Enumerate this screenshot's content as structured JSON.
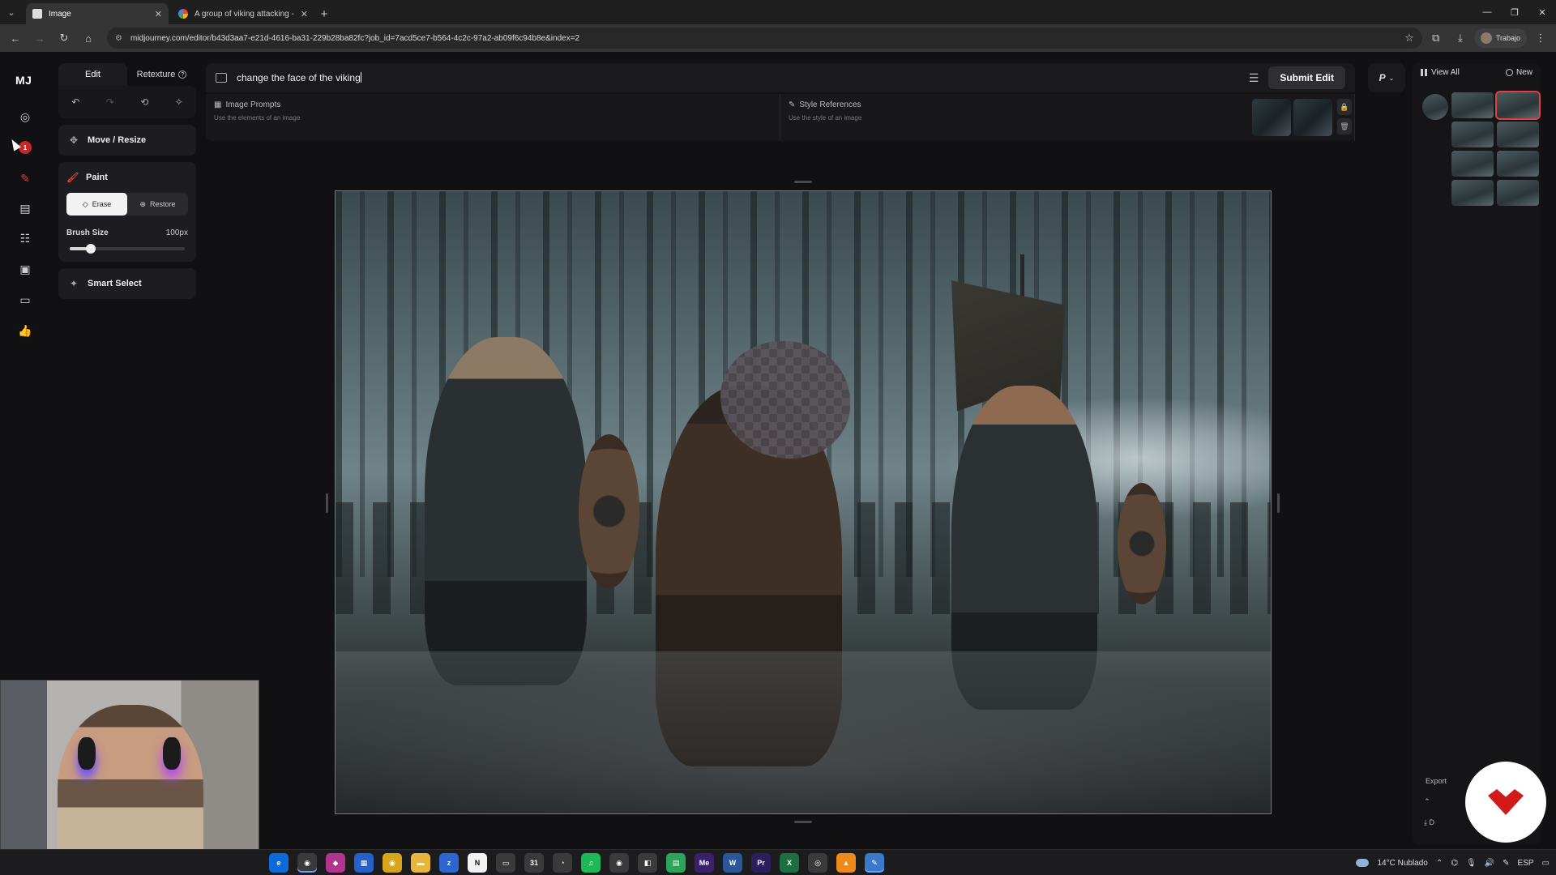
{
  "browser": {
    "tabs": [
      {
        "title": "Image",
        "active": true
      },
      {
        "title": "A group of viking attacking - G",
        "active": false
      }
    ],
    "url": "midjourney.com/editor/b43d3aa7-e21d-4616-ba31-229b28ba82fc?job_id=7acd5ce7-b564-4c2c-97a2-ab09f6c94b8e&index=2",
    "profile_label": "Trabajo"
  },
  "rail": {
    "logo": "MJ",
    "notification_count": "1"
  },
  "tools": {
    "tab_edit": "Edit",
    "tab_retexture": "Retexture",
    "move_resize": "Move / Resize",
    "paint": "Paint",
    "erase": "Erase",
    "restore": "Restore",
    "brush_size_label": "Brush Size",
    "brush_size_value": "100px",
    "brush_size_fraction": 0.18,
    "smart_select": "Smart Select"
  },
  "prompt": {
    "text": "change the face of the viking",
    "submit_label": "Submit Edit",
    "param_menu": "P"
  },
  "references": {
    "image_prompts_title": "Image Prompts",
    "image_prompts_sub": "Use the elements of an image",
    "style_refs_title": "Style References",
    "style_refs_sub": "Use the style of an image"
  },
  "right_panel": {
    "view_all": "View All",
    "new": "New",
    "export_label": "Export",
    "download_label": "D"
  },
  "taskbar": {
    "weather": "14°C  Nublado",
    "language": "ESP"
  },
  "colors": {
    "accent_red": "#e24040",
    "background": "#111113"
  }
}
